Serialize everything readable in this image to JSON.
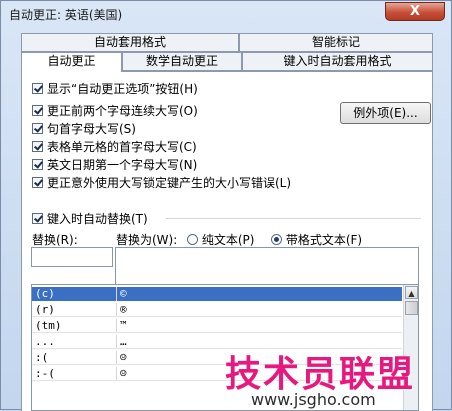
{
  "window": {
    "title": "自动更正: 英语(美国)",
    "close_label": "X"
  },
  "tabs_row1": [
    {
      "label": "自动套用格式"
    },
    {
      "label": "智能标记"
    }
  ],
  "tabs_row2": [
    {
      "label": "自动更正",
      "active": true
    },
    {
      "label": "数学自动更正"
    },
    {
      "label": "键入时自动套用格式"
    }
  ],
  "options": [
    {
      "label": "显示“自动更正选项”按钮(H)",
      "checked": true
    },
    {
      "label": "更正前两个字母连续大写(O)",
      "checked": true
    },
    {
      "label": "句首字母大写(S)",
      "checked": true
    },
    {
      "label": "表格单元格的首字母大写(C)",
      "checked": true
    },
    {
      "label": "英文日期第一个字母大写(N)",
      "checked": true
    },
    {
      "label": "更正意外使用大写锁定键产生的大小写错误(L)",
      "checked": true
    }
  ],
  "exceptions_button": "例外项(E)...",
  "replace_section": {
    "checkbox_label": "键入时自动替换(T)",
    "replace_label": "替换(R):",
    "with_label": "替换为(W):",
    "plain_text_label": "纯文本(P)",
    "formatted_text_label": "带格式文本(F)",
    "replace_value": "",
    "with_value": ""
  },
  "list_rows": [
    {
      "from": "(c)",
      "to": "©"
    },
    {
      "from": "(r)",
      "to": "®"
    },
    {
      "from": "(tm)",
      "to": "™"
    },
    {
      "from": "...",
      "to": "…"
    },
    {
      "from": ":(",
      "to": "☹"
    },
    {
      "from": ":-(",
      "to": "☹"
    }
  ],
  "watermark": {
    "name": "技术员联盟",
    "url": "www.jsgho.com"
  },
  "colors": {
    "selection": "#3a6fc4",
    "close_button": "#c7503a",
    "watermark": "#e7197e"
  }
}
